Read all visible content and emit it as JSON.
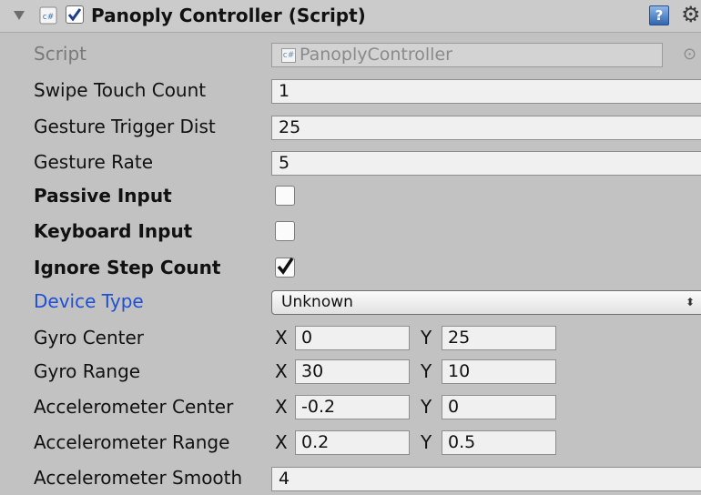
{
  "header": {
    "title": "Panoply Controller (Script)",
    "enabled": true
  },
  "script_row": {
    "label": "Script",
    "value": "PanoplyController"
  },
  "fields": {
    "swipe_touch_count": {
      "label": "Swipe Touch Count",
      "value": "1"
    },
    "gesture_trigger_dist": {
      "label": "Gesture Trigger Dist",
      "value": "25"
    },
    "gesture_rate": {
      "label": "Gesture Rate",
      "value": "5"
    },
    "passive_input": {
      "label": "Passive Input",
      "checked": false
    },
    "keyboard_input": {
      "label": "Keyboard Input",
      "checked": false
    },
    "ignore_step_count": {
      "label": "Ignore Step Count",
      "checked": true
    },
    "device_type": {
      "label": "Device Type",
      "value": "Unknown",
      "arrows": "⬍"
    },
    "gyro_center": {
      "label": "Gyro Center",
      "x_label": "X",
      "y_label": "Y",
      "x": "0",
      "y": "25"
    },
    "gyro_range": {
      "label": "Gyro Range",
      "x_label": "X",
      "y_label": "Y",
      "x": "30",
      "y": "10"
    },
    "accel_center": {
      "label": "Accelerometer Center",
      "x_label": "X",
      "y_label": "Y",
      "x": "-0.2",
      "y": "0"
    },
    "accel_range": {
      "label": "Accelerometer Range",
      "x_label": "X",
      "y_label": "Y",
      "x": "0.2",
      "y": "0.5"
    },
    "accel_smooth": {
      "label": "Accelerometer Smooth",
      "value": "4"
    }
  },
  "icons": {
    "fold": "triangle-down-icon",
    "script": "csharp-script-icon",
    "help": "help-book-icon",
    "settings": "gear-icon",
    "object_picker": "target-circle-icon"
  },
  "colors": {
    "panel_bg": "#c2c2c2",
    "modified_label": "#1f4fd6",
    "field_bg": "#f0f0f0"
  }
}
